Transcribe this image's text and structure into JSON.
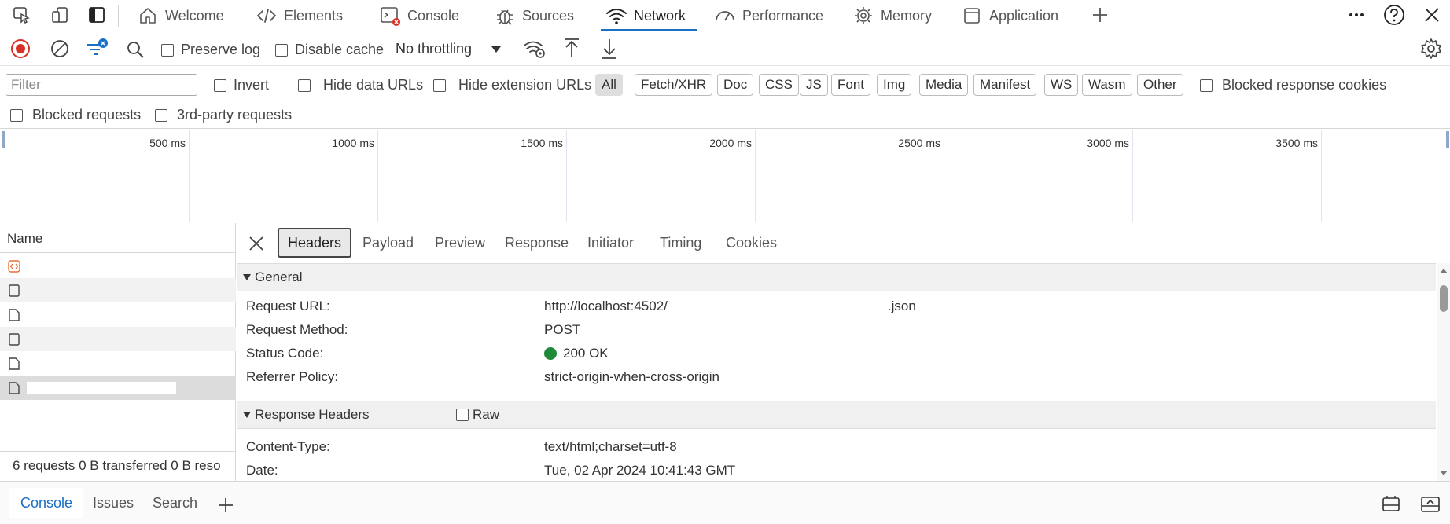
{
  "tabs": [
    {
      "label": "Welcome",
      "icon": "home-icon"
    },
    {
      "label": "Elements",
      "icon": "code-icon"
    },
    {
      "label": "Console",
      "icon": "console-icon"
    },
    {
      "label": "Sources",
      "icon": "bug-icon"
    },
    {
      "label": "Network",
      "icon": "wifi-icon",
      "active": true
    },
    {
      "label": "Performance",
      "icon": "gauge-icon"
    },
    {
      "label": "Memory",
      "icon": "chip-icon"
    },
    {
      "label": "Application",
      "icon": "window-icon"
    }
  ],
  "toolbar": {
    "preserve_log": "Preserve log",
    "disable_cache": "Disable cache",
    "throttling": "No throttling"
  },
  "filters": {
    "placeholder": "Filter",
    "invert": "Invert",
    "hide_data_urls": "Hide data URLs",
    "hide_extension_urls": "Hide extension URLs",
    "types": [
      "All",
      "Fetch/XHR",
      "Doc",
      "CSS",
      "JS",
      "Font",
      "Img",
      "Media",
      "Manifest",
      "WS",
      "Wasm",
      "Other"
    ],
    "blocked_response_cookies": "Blocked response cookies",
    "blocked_requests": "Blocked requests",
    "third_party": "3rd-party requests"
  },
  "timeline": {
    "labels": [
      "500 ms",
      "1000 ms",
      "1500 ms",
      "2000 ms",
      "2500 ms",
      "3000 ms",
      "3500 ms"
    ]
  },
  "requests": {
    "header": "Name",
    "summary": "6 requests  0 B transferred  0 B reso"
  },
  "details": {
    "tabs": [
      "Headers",
      "Payload",
      "Preview",
      "Response",
      "Initiator",
      "Timing",
      "Cookies"
    ],
    "general": {
      "title": "General",
      "request_url_key": "Request URL:",
      "request_url_val": "http://localhost:4502/",
      "request_url_tail": ".json",
      "method_key": "Request Method:",
      "method_val": "POST",
      "status_key": "Status Code:",
      "status_val": "200 OK",
      "referrer_key": "Referrer Policy:",
      "referrer_val": "strict-origin-when-cross-origin"
    },
    "response_headers": {
      "title": "Response Headers",
      "raw": "Raw",
      "content_type_key": "Content-Type:",
      "content_type_val": "text/html;charset=utf-8",
      "date_key": "Date:",
      "date_val": "Tue, 02 Apr 2024 10:41:43 GMT"
    }
  },
  "drawer": {
    "tabs": [
      "Console",
      "Issues",
      "Search"
    ]
  },
  "colors": {
    "accent": "#1a6fc7",
    "record": "#d93025",
    "status_ok": "#1f8a3a"
  }
}
